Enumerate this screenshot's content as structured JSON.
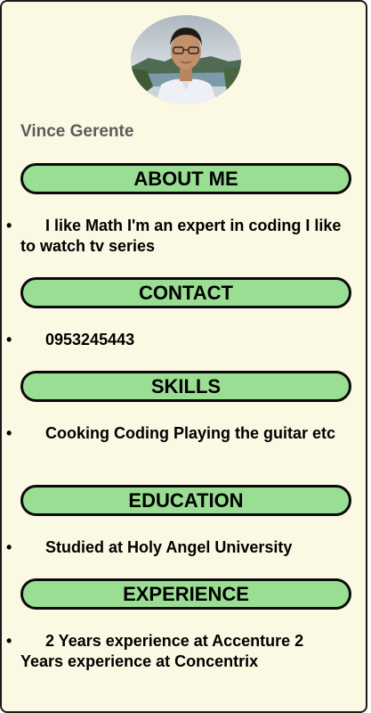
{
  "profile": {
    "name": "Vince Gerente"
  },
  "sections": [
    {
      "title": "ABOUT ME",
      "text": "I like Math I'm an expert in coding I like to watch tv series"
    },
    {
      "title": "CONTACT",
      "text": "0953245443"
    },
    {
      "title": "SKILLS",
      "text": "Cooking Coding Playing the guitar etc"
    },
    {
      "title": "EDUCATION",
      "text": "Studied at Holy Angel University"
    },
    {
      "title": "EXPERIENCE",
      "text": "2 Years experience at Accenture 2 Years experience at Concentrix"
    }
  ],
  "bullet_char": "•",
  "colors": {
    "page_bg": "#fbf9e4",
    "section_bg": "#9ade94",
    "name_color": "#5b5b5b"
  }
}
